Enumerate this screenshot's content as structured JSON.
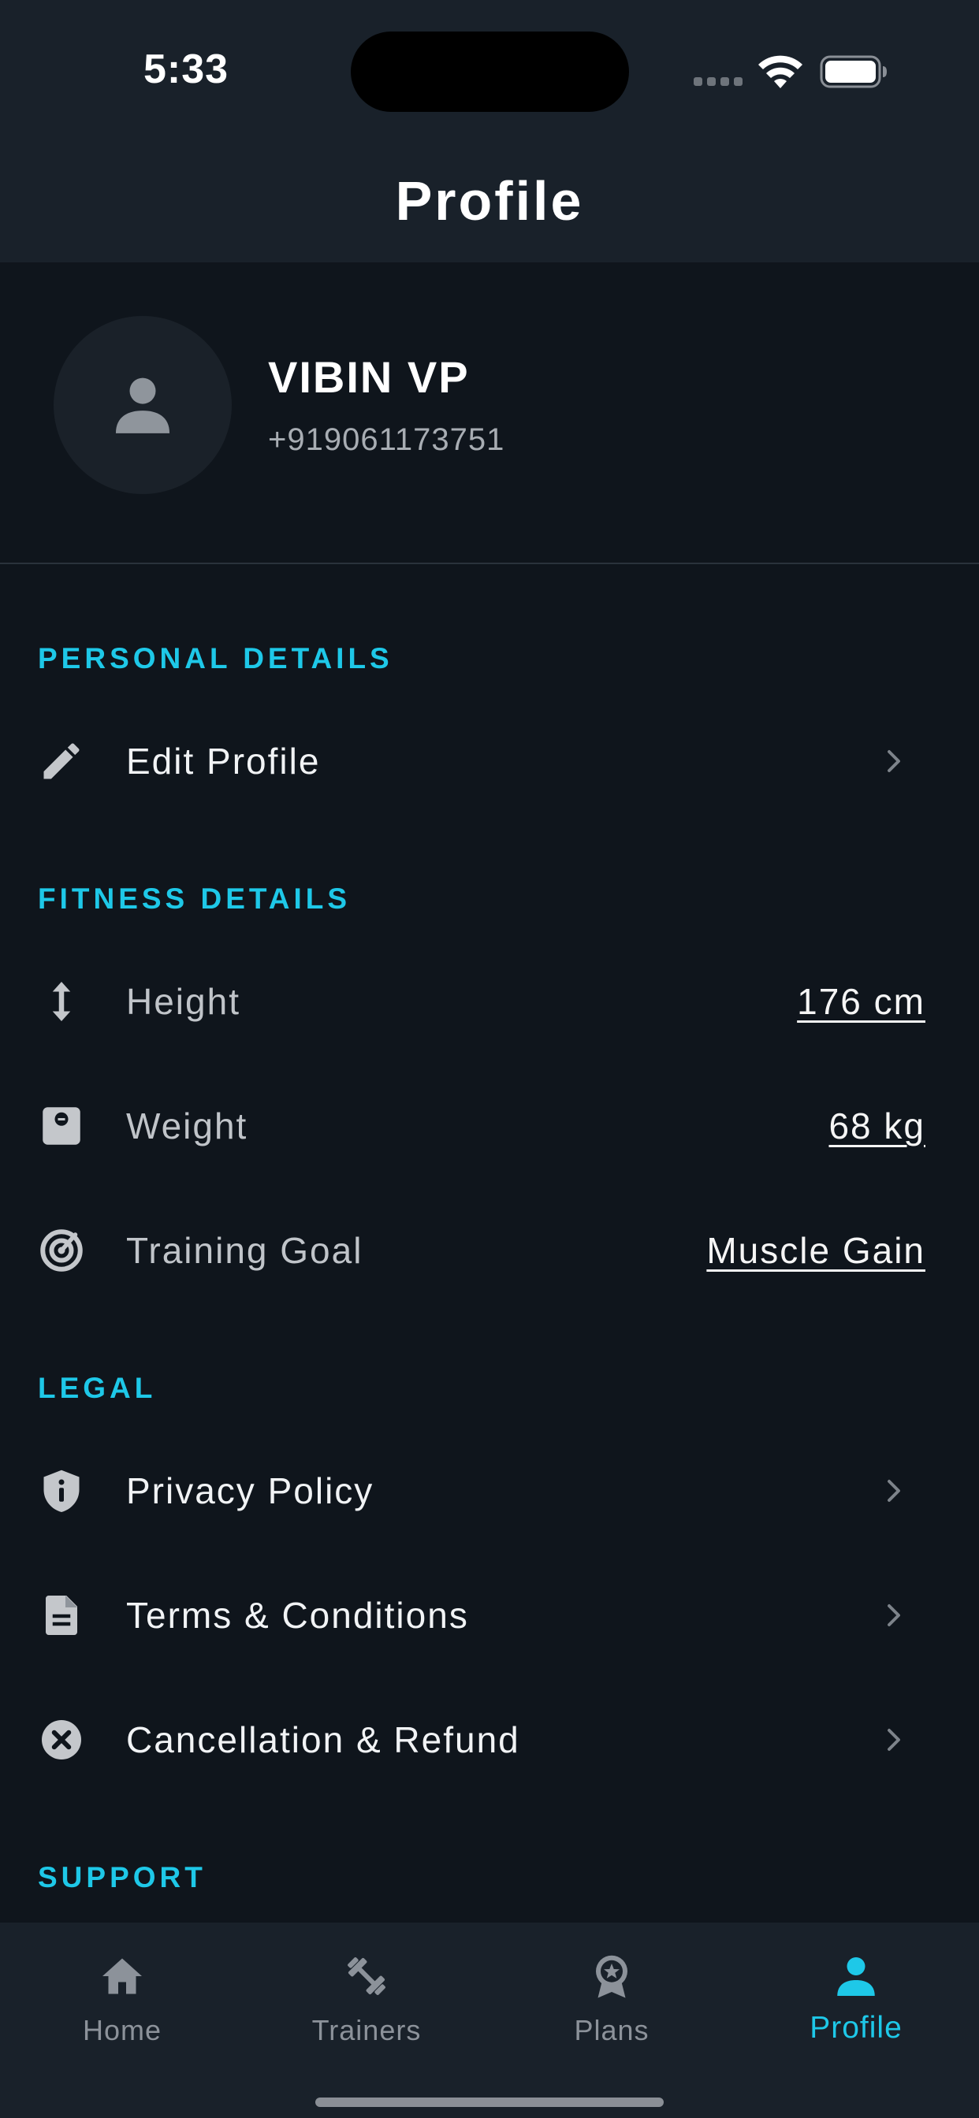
{
  "status_bar": {
    "time": "5:33"
  },
  "header": {
    "title": "Profile"
  },
  "profile": {
    "name": "VIBIN VP",
    "phone": "+919061173751",
    "avatar_icon": "person-icon"
  },
  "sections": {
    "personal": {
      "title": "PERSONAL DETAILS",
      "edit_profile": {
        "label": "Edit Profile",
        "icon": "pencil-icon"
      }
    },
    "fitness": {
      "title": "FITNESS DETAILS",
      "height": {
        "label": "Height",
        "value": "176 cm",
        "icon": "vertical-arrows-icon"
      },
      "weight": {
        "label": "Weight",
        "value": "68 kg",
        "icon": "scale-icon"
      },
      "goal": {
        "label": "Training Goal",
        "value": "Muscle Gain",
        "icon": "target-icon"
      }
    },
    "legal": {
      "title": "LEGAL",
      "privacy": {
        "label": "Privacy Policy",
        "icon": "shield-info-icon"
      },
      "terms": {
        "label": "Terms & Conditions",
        "icon": "document-icon"
      },
      "cancellation": {
        "label": "Cancellation & Refund",
        "icon": "cancel-circle-icon"
      }
    },
    "support": {
      "title": "SUPPORT"
    }
  },
  "tabbar": {
    "tabs": [
      {
        "label": "Home",
        "icon": "home-icon",
        "active": false
      },
      {
        "label": "Trainers",
        "icon": "dumbbell-icon",
        "active": false
      },
      {
        "label": "Plans",
        "icon": "award-badge-icon",
        "active": false
      },
      {
        "label": "Profile",
        "icon": "person-icon",
        "active": true
      }
    ]
  },
  "colors": {
    "background": "#0f151c",
    "surface": "#19212a",
    "accent": "#1ec8e8",
    "text_primary": "#f1f3f5",
    "text_secondary": "#a8adb3",
    "icon_muted": "#c4c7cb"
  }
}
